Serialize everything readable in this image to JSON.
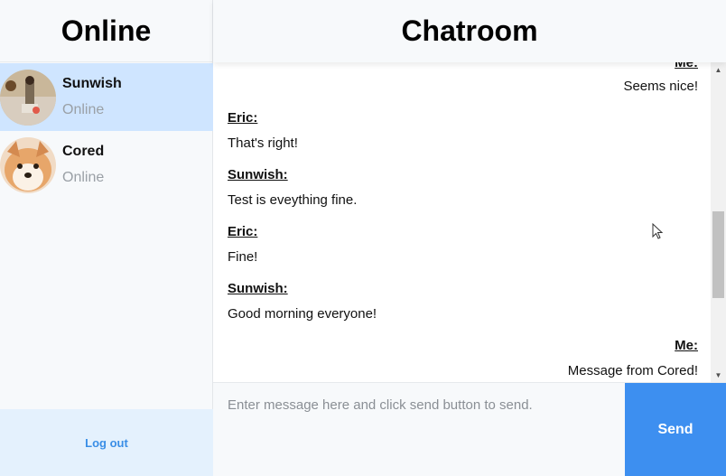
{
  "sidebar": {
    "title": "Online",
    "users": [
      {
        "name": "Sunwish",
        "status": "Online",
        "active": true
      },
      {
        "name": "Cored",
        "status": "Online",
        "active": false
      }
    ],
    "logout_label": "Log out"
  },
  "main": {
    "title": "Chatroom",
    "messages": [
      {
        "sender": "Me:",
        "text": "Seems nice!",
        "align": "right"
      },
      {
        "sender": "Eric:",
        "text": "That's right!",
        "align": "left"
      },
      {
        "sender": "Sunwish:",
        "text": "Test is eveything fine.",
        "align": "left"
      },
      {
        "sender": "Eric:",
        "text": "Fine!",
        "align": "left"
      },
      {
        "sender": "Sunwish:",
        "text": "Good morning everyone!",
        "align": "left"
      },
      {
        "sender": "Me:",
        "text": "Message from Cored!",
        "align": "right"
      }
    ]
  },
  "composer": {
    "placeholder": "Enter message here and click send button to send.",
    "value": "",
    "send_label": "Send"
  },
  "colors": {
    "accent": "#3d8ff0",
    "active_user_bg": "#cfe5ff",
    "logout_bg": "#e4f1fd",
    "link": "#3a8ee6"
  },
  "icons": [
    "user-avatar-sunwish",
    "user-avatar-cored",
    "scroll-up-arrow-icon",
    "scroll-down-arrow-icon",
    "mouse-cursor-icon"
  ]
}
